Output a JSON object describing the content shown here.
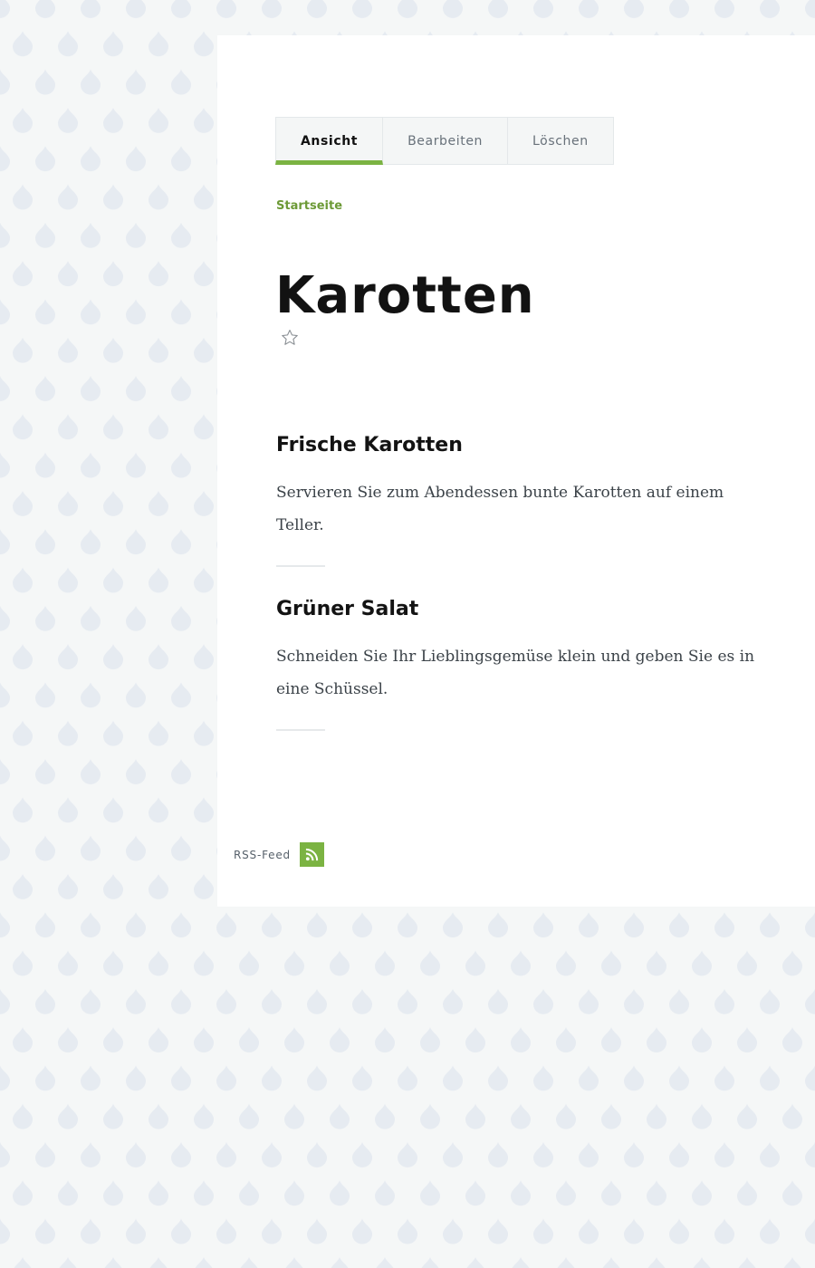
{
  "tabs": [
    {
      "label": "Ansicht",
      "active": true
    },
    {
      "label": "Bearbeiten",
      "active": false
    },
    {
      "label": "Löschen",
      "active": false
    }
  ],
  "breadcrumb": {
    "label": "Startseite"
  },
  "page": {
    "title": "Karotten"
  },
  "articles": [
    {
      "title": "Frische Karotten",
      "body": "Servieren Sie zum Abendessen bunte Karotten auf einem Teller."
    },
    {
      "title": "Grüner Salat",
      "body": "Schneiden Sie Ihr Lieblingsgemüse klein und geben Sie es in eine Schüssel."
    }
  ],
  "footer": {
    "rss_label": "RSS-Feed"
  },
  "icons": {
    "favorite": "star-outline-icon",
    "feed": "rss-icon"
  },
  "colors": {
    "accent": "#7bb342",
    "breadcrumb": "#6d9a37",
    "background": "#f5f7f7",
    "drop_pattern": "#e6ebf1"
  }
}
